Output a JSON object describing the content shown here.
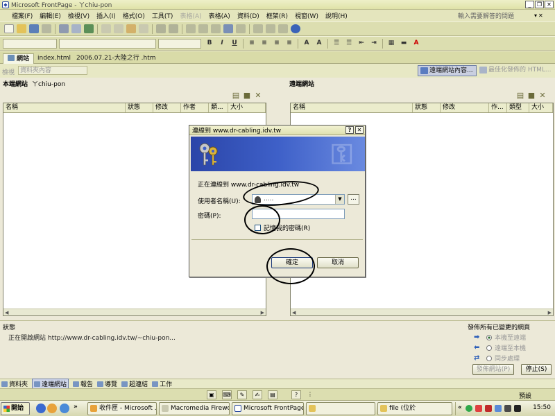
{
  "window": {
    "title": "Microsoft FrontPage - ㄚchiu-pon",
    "buttons": [
      "_",
      "❐",
      "✕"
    ]
  },
  "menu": {
    "items": [
      {
        "label": "檔案(F)",
        "disabled": false
      },
      {
        "label": "編輯(E)",
        "disabled": false
      },
      {
        "label": "檢視(V)",
        "disabled": false
      },
      {
        "label": "插入(I)",
        "disabled": false
      },
      {
        "label": "格式(O)",
        "disabled": false
      },
      {
        "label": "工具(T)",
        "disabled": false
      },
      {
        "label": "表格(A)",
        "disabled": true
      },
      {
        "label": "表格(A)",
        "disabled": false
      },
      {
        "label": "資料(D)",
        "disabled": false
      },
      {
        "label": "框架(R)",
        "disabled": false
      },
      {
        "label": "視窗(W)",
        "disabled": false
      },
      {
        "label": "說明(H)",
        "disabled": false
      }
    ],
    "help_placeholder": "輸入需要解答的問題"
  },
  "tabs": [
    {
      "label": "網站",
      "active": true
    },
    {
      "label": "index.html",
      "active": false
    },
    {
      "label": "2006.07.21-大陸之行 .htm",
      "active": false
    }
  ],
  "view_row": {
    "label": "檢視",
    "select_value": "資料夾內容",
    "remote_button": "遠端網站內容...",
    "optimize_button": "最佳化發佈的 HTML..."
  },
  "local_pane": {
    "title": "本端網站",
    "path": "ㄚchiu-pon",
    "columns": [
      "名稱",
      "狀態",
      "修改",
      "作者",
      "類...",
      "大小"
    ]
  },
  "remote_pane": {
    "title": "遠端網站",
    "columns": [
      "名稱",
      "狀態",
      "修改",
      "作...",
      "類型",
      "大小"
    ]
  },
  "status": {
    "label": "狀態",
    "message": "正在開啟網站 http://www.dr-cabling.idv.tw/~chiu-pon..."
  },
  "publish": {
    "title": "發佈所有已變更的網頁",
    "options": [
      {
        "label": "本機至遠端",
        "checked": true
      },
      {
        "label": "遠端至本機",
        "checked": false
      },
      {
        "label": "同步處理",
        "checked": false
      }
    ],
    "publish_button": "發佈網站(P)",
    "stop_button": "停止(S)"
  },
  "view_bar": [
    {
      "label": "資料夾",
      "active": false
    },
    {
      "label": "遠端網站",
      "active": true
    },
    {
      "label": "報告",
      "active": false
    },
    {
      "label": "導覽",
      "active": false
    },
    {
      "label": "超連結",
      "active": false
    },
    {
      "label": "工作",
      "active": false
    }
  ],
  "status_bar": {
    "preset": "預設"
  },
  "dialog": {
    "title": "連線到 www.dr-cabling.idv.tw",
    "help_btn": "?",
    "close_btn": "✕",
    "connecting_text": "正在連線到 www.dr-cabling.idv.tw",
    "username_label": "使用者名稱(U):",
    "username_value": ".....",
    "password_label": "密碼(P):",
    "password_value": "",
    "remember_label": "記憶我的密碼(R)",
    "ok_button": "確定",
    "cancel_button": "取消",
    "browse_button": "..."
  },
  "taskbar": {
    "start_label": "開始",
    "more": "»",
    "tasks": [
      {
        "label": "收件匣 - Microsoft ...",
        "active": false
      },
      {
        "label": "Macromedia Firewo...",
        "active": false
      },
      {
        "label": "Microsoft FrontPage...",
        "active": true
      },
      {
        "label": "",
        "active": false
      },
      {
        "label": "file (位於",
        "active": false
      }
    ],
    "tray_more": "«",
    "clock": "15:50"
  },
  "colors": {
    "chrome": "#ece9d8",
    "toolbar": "#dcdeb0",
    "banner": "#2b45a8",
    "accent": "#2a5db8"
  }
}
